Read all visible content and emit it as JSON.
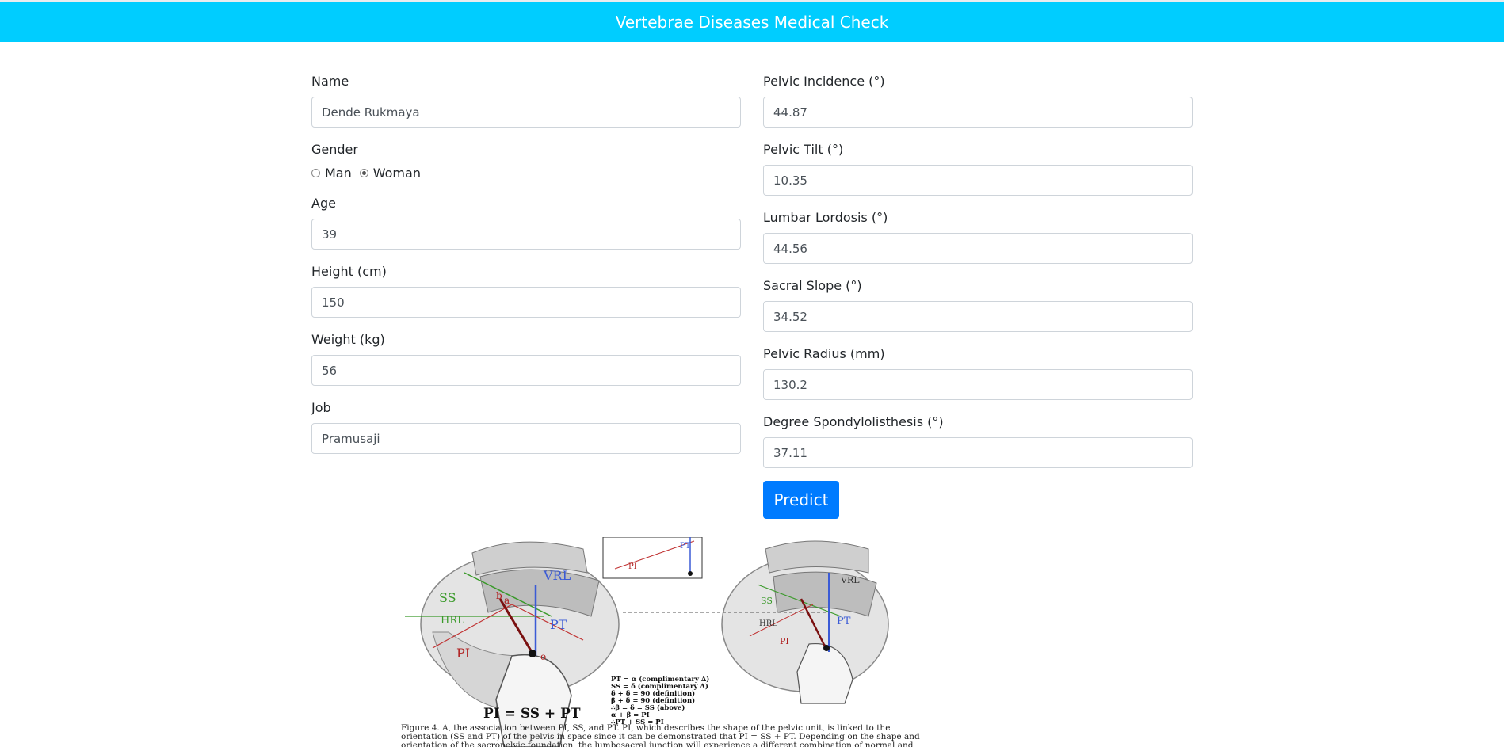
{
  "header": {
    "title": "Vertebrae Diseases Medical Check"
  },
  "form": {
    "name": {
      "label": "Name",
      "value": "Dende Rukmaya"
    },
    "gender": {
      "label": "Gender",
      "options": [
        "Man",
        "Woman"
      ],
      "selected": "Woman"
    },
    "age": {
      "label": "Age",
      "value": "39"
    },
    "height": {
      "label": "Height (cm)",
      "value": "150"
    },
    "weight": {
      "label": "Weight (kg)",
      "value": "56"
    },
    "job": {
      "label": "Job",
      "value": "Pramusaji"
    },
    "pelvic_incidence": {
      "label": "Pelvic Incidence (°)",
      "value": "44.87"
    },
    "pelvic_tilt": {
      "label": "Pelvic Tilt (°)",
      "value": "10.35"
    },
    "lumbar_lordosis": {
      "label": "Lumbar Lordosis (°)",
      "value": "44.56"
    },
    "sacral_slope": {
      "label": "Sacral Slope (°)",
      "value": "34.52"
    },
    "pelvic_radius": {
      "label": "Pelvic Radius (mm)",
      "value": "130.2"
    },
    "degree_spondylolisthesis": {
      "label": "Degree Spondylolisthesis (°)",
      "value": "37.11"
    },
    "predict_label": "Predict"
  },
  "figure": {
    "left_labels": {
      "ss": "SS",
      "vrl": "VRL",
      "hrl": "HRL",
      "pt": "PT",
      "pi": "PI",
      "o": "o",
      "a": "a",
      "b": "b"
    },
    "right_labels": {
      "ss": "SS",
      "vrl": "VRL",
      "hrl": "HRL",
      "pt": "PT",
      "pi": "PI"
    },
    "inset_labels": {
      "pt": "PT",
      "pi": "PI"
    },
    "equation": "PI = SS + PT",
    "proof_lines": [
      "PT = α  (complimentary ∆)",
      "SS =  δ  (complimentary ∆)",
      "δ + δ = 90 (definition)",
      "β + δ = 90 (definition)",
      "∴β = δ = SS (above)",
      "α + β = PI",
      "∴PT + SS = PI"
    ],
    "caption_lines": [
      "Figure 4. A, the association between PI, SS, and PT. PI, which describes the shape of the pelvic unit, is linked to the",
      "orientation (SS and PT) of the pelvis in space since it can be demonstrated that PI = SS + PT. Depending on the shape and",
      "orientation of the sacropelvic foundation, the lumbosacral junction will experience a different combination of normal and"
    ]
  }
}
